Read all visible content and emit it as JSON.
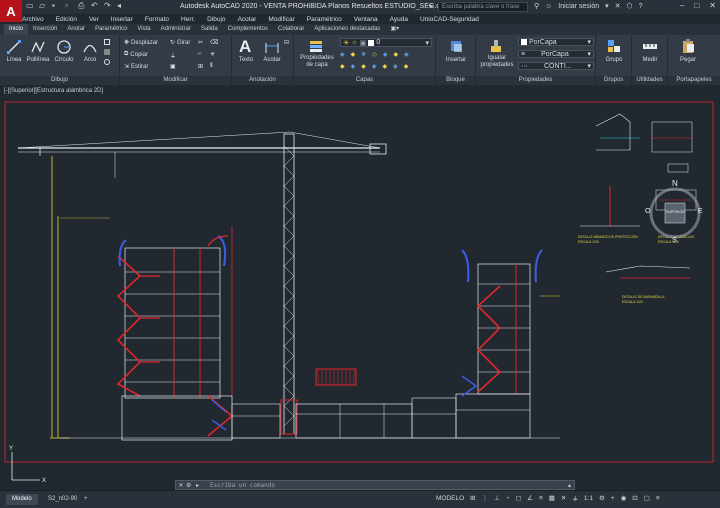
{
  "app": {
    "logo": "A",
    "title": "Autodesk AutoCAD 2020 - VENTA PROHIBIDA   Planos Resueltos ESTUDIO_SEG.dwg",
    "search_placeholder": "Escriba palabra clave o frase",
    "signin": "Iniciar sesión"
  },
  "menu": [
    "Archivo",
    "Edición",
    "Ver",
    "Insertar",
    "Formato",
    "Herr.",
    "Dibujo",
    "Acotar",
    "Modificar",
    "Paramétrico",
    "Ventana",
    "Ayuda",
    "UnioCAD-Seguridad"
  ],
  "ribbon_tabs": [
    "Inicio",
    "Inserción",
    "Anotar",
    "Paramétrico",
    "Vista",
    "Administrar",
    "Salida",
    "Complementos",
    "Colaborar",
    "Aplicaciones destacadas"
  ],
  "ribbon": {
    "dibujo": {
      "title": "Dibujo",
      "linea": "Línea",
      "polilinea": "Polilínea",
      "circulo": "Círculo",
      "arco": "Arco"
    },
    "modificar": {
      "title": "Modificar",
      "desplazar": "Desplazar",
      "girar": "Girar",
      "copiar": "Copiar",
      "estirar": "Estirar"
    },
    "anotacion": {
      "title": "Anotación",
      "texto": "Texto",
      "acotar": "Acotar"
    },
    "capas": {
      "title": "Capas",
      "propiedades": "Propiedades de capa",
      "layer_value": "0"
    },
    "bloque": {
      "title": "Bloque",
      "insertar": "Insertar"
    },
    "propiedades": {
      "title": "Propiedades",
      "igualar": "Igualar propiedades",
      "color": "PorCapa",
      "linetype": "PorCapa",
      "lineweight": "CONTI..."
    },
    "grupos": {
      "title": "Grupos",
      "grupo": "Grupo"
    },
    "utilidades": {
      "title": "Utilidades",
      "medir": "Medir"
    },
    "portapapeles": {
      "title": "Portapapeles",
      "pegar": "Pegar"
    }
  },
  "viewport": {
    "label": "[-][Superior][Estructura alámbrica 2D]",
    "viewcube": {
      "top": "N",
      "left": "O",
      "right": "E",
      "bottom": "S",
      "face": "SUPERIOR"
    }
  },
  "drawing_notes": [
    "DETALLE ARMADO DE PROTECCIÓN",
    "ESCALA 1/20",
    "DETALLE DE ANCLAJE",
    "ESCALA 1/10",
    "DETALLE DE BARANDILLA",
    "ESCALA 1/20"
  ],
  "command": {
    "close": "✕",
    "prompt": "Escriba un comando"
  },
  "status": {
    "tabs": [
      "Modelo",
      "S2_n02-90"
    ],
    "add": "+",
    "mode": "MODELO",
    "scale": "1:1"
  },
  "colors": {
    "background": "#212830",
    "ribbon": "#333b47",
    "red": "#e0262c",
    "white": "#e8ecef",
    "yellow": "#e6d93a",
    "blue": "#3a5fe6",
    "cyan": "#35c9d0"
  }
}
